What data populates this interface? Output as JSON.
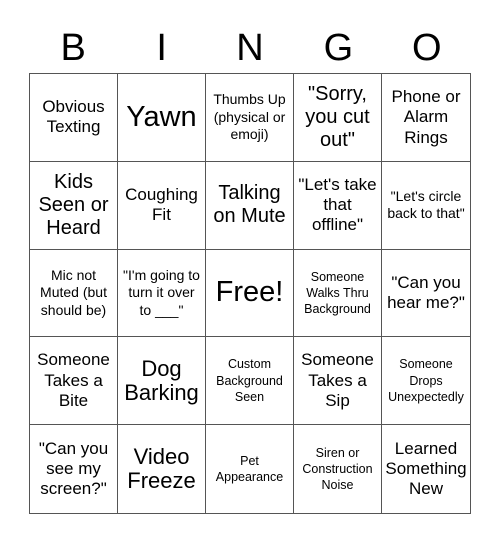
{
  "header": {
    "letters": [
      "B",
      "I",
      "N",
      "G",
      "O"
    ]
  },
  "cells": [
    {
      "text": "Obvious Texting"
    },
    {
      "text": "Yawn"
    },
    {
      "text": "Thumbs Up (physical or emoji)"
    },
    {
      "text": "\"Sorry, you cut out\""
    },
    {
      "text": "Phone or Alarm Rings"
    },
    {
      "text": "Kids Seen or Heard"
    },
    {
      "text": "Coughing Fit"
    },
    {
      "text": "Talking on Mute"
    },
    {
      "text": "\"Let's take that offline\""
    },
    {
      "text": "\"Let's circle back to that\""
    },
    {
      "text": "Mic not Muted (but should be)"
    },
    {
      "text": "\"I'm going to turn it over to ___\""
    },
    {
      "text": "Free!"
    },
    {
      "text": "Someone Walks Thru Background"
    },
    {
      "text": "\"Can you hear me?\""
    },
    {
      "text": "Someone Takes a Bite"
    },
    {
      "text": "Dog Barking"
    },
    {
      "text": "Custom Background Seen"
    },
    {
      "text": "Someone Takes a Sip"
    },
    {
      "text": "Someone Drops Unexpectedly"
    },
    {
      "text": "\"Can you see my screen?\""
    },
    {
      "text": "Video Freeze"
    },
    {
      "text": "Pet Appearance"
    },
    {
      "text": "Siren or Construction Noise"
    },
    {
      "text": "Learned Something New"
    }
  ]
}
